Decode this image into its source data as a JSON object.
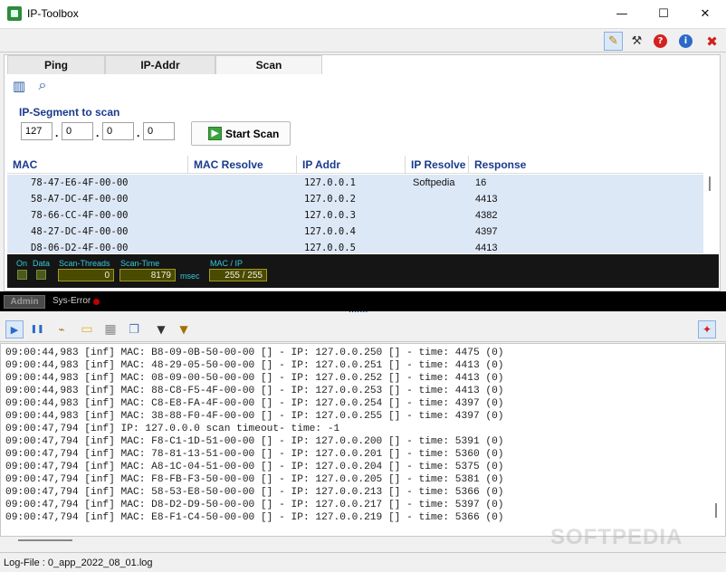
{
  "window": {
    "title": "IP-Toolbox",
    "controls": {
      "minimize": "—",
      "maximize": "☐",
      "close": "✕"
    }
  },
  "top_toolbar": {
    "icons": [
      "edit-icon",
      "tools-icon",
      "help-icon",
      "info-icon",
      "close-icon"
    ],
    "glyphs": {
      "edit": "✎",
      "tools": "⚒",
      "help": "?",
      "info": "i",
      "close": "✖"
    }
  },
  "tabs": [
    {
      "label": "Ping",
      "active": false
    },
    {
      "label": "IP-Addr",
      "active": false
    },
    {
      "label": "Scan",
      "active": true
    }
  ],
  "scan_toolbar": {
    "icons": [
      "book-icon",
      "search-icon"
    ],
    "glyphs": {
      "book": "▥",
      "search": "⌕"
    }
  },
  "segment": {
    "label": "IP-Segment to scan",
    "octets": [
      "127",
      "0",
      "0",
      "0"
    ],
    "dot": "."
  },
  "start_scan": {
    "label": "Start Scan",
    "icon": "▶"
  },
  "table": {
    "columns": [
      "MAC",
      "MAC Resolve",
      "IP Addr",
      "IP Resolve",
      "Response"
    ],
    "rows": [
      {
        "mac": "78-47-E6-4F-00-00",
        "mac_resolve": "",
        "ip": "127.0.0.1",
        "ip_resolve": "Softpedia",
        "response": "16"
      },
      {
        "mac": "58-A7-DC-4F-00-00",
        "mac_resolve": "",
        "ip": "127.0.0.2",
        "ip_resolve": "",
        "response": "4413"
      },
      {
        "mac": "78-66-CC-4F-00-00",
        "mac_resolve": "",
        "ip": "127.0.0.3",
        "ip_resolve": "",
        "response": "4382"
      },
      {
        "mac": "48-27-DC-4F-00-00",
        "mac_resolve": "",
        "ip": "127.0.0.4",
        "ip_resolve": "",
        "response": "4397"
      },
      {
        "mac": "D8-06-D2-4F-00-00",
        "mac_resolve": "",
        "ip": "127.0.0.5",
        "ip_resolve": "",
        "response": "4413"
      }
    ]
  },
  "status": {
    "on_label": "On",
    "data_label": "Data",
    "threads_label": "Scan-Threads",
    "threads_value": "0",
    "time_label": "Scan-Time",
    "time_value": "8179",
    "time_unit": "msec",
    "macip_label": "MAC / IP",
    "macip_value": "255 / 255"
  },
  "admin_bar": {
    "admin_label": "Admin",
    "syserr_label": "Sys-Error"
  },
  "log_toolbar": {
    "icons": [
      "play-icon",
      "pause-icon",
      "broom-icon",
      "folder-icon",
      "grid-icon",
      "copy-icon",
      "filter-icon",
      "filter-edit-icon",
      "pin-icon"
    ],
    "glyphs": {
      "play": "▶",
      "pause": "❚❚",
      "broom": "⌁",
      "folder": "▭",
      "grid": "▦",
      "copy": "❐",
      "filter": "▼",
      "filter_edit": "▼",
      "pin": "✦"
    }
  },
  "log_lines": [
    "09:00:44,983 [inf] MAC: B8-09-0B-50-00-00 [] - IP: 127.0.0.250 [] - time: 4475 (0)",
    "09:00:44,983 [inf] MAC: 48-29-05-50-00-00 [] - IP: 127.0.0.251 [] - time: 4413 (0)",
    "09:00:44,983 [inf] MAC: 08-09-00-50-00-00 [] - IP: 127.0.0.252 [] - time: 4413 (0)",
    "09:00:44,983 [inf] MAC: 88-C8-F5-4F-00-00 [] - IP: 127.0.0.253 [] - time: 4413 (0)",
    "09:00:44,983 [inf] MAC: C8-E8-FA-4F-00-00 [] - IP: 127.0.0.254 [] - time: 4397 (0)",
    "09:00:44,983 [inf] MAC: 38-88-F0-4F-00-00 [] - IP: 127.0.0.255 [] - time: 4397 (0)",
    "09:00:47,794 [inf] IP: 127.0.0.0 scan timeout- time: -1",
    "09:00:47,794 [inf] MAC: F8-C1-1D-51-00-00 [] - IP: 127.0.0.200 [] - time: 5391 (0)",
    "09:00:47,794 [inf] MAC: 78-81-13-51-00-00 [] - IP: 127.0.0.201 [] - time: 5360 (0)",
    "09:00:47,794 [inf] MAC: A8-1C-04-51-00-00 [] - IP: 127.0.0.204 [] - time: 5375 (0)",
    "09:00:47,794 [inf] MAC: F8-FB-F3-50-00-00 [] - IP: 127.0.0.205 [] - time: 5381 (0)",
    "09:00:47,794 [inf] MAC: 58-53-E8-50-00-00 [] - IP: 127.0.0.213 [] - time: 5366 (0)",
    "09:00:47,794 [inf] MAC: D8-D2-D9-50-00-00 [] - IP: 127.0.0.217 [] - time: 5397 (0)",
    "09:00:47,794 [inf] MAC: E8-F1-C4-50-00-00 [] - IP: 127.0.0.219 [] - time: 5366 (0)"
  ],
  "statusbar": {
    "logfile": "Log-File : 0_app_2022_08_01.log"
  },
  "watermark": "SOFTPEDIA"
}
